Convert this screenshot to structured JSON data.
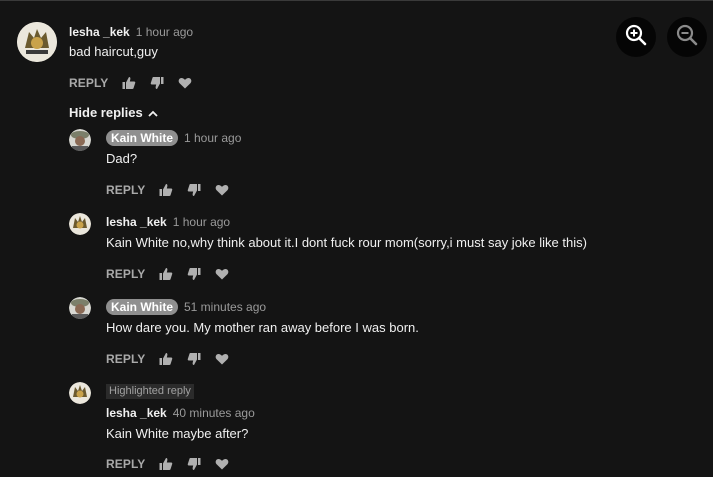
{
  "toolbar": {
    "zoom_in_icon": "zoom-in-icon",
    "zoom_out_icon": "zoom-out-icon"
  },
  "reply_label": "REPLY",
  "hide_replies_label": "Hide replies",
  "highlighted_label": "Highlighted reply",
  "comments": [
    {
      "author": "lesha _kek",
      "time": "1 hour ago",
      "text": "bad haircut,guy"
    },
    {
      "author": "Kain White",
      "time": "1 hour ago",
      "text": "Dad?"
    },
    {
      "author": "lesha _kek",
      "time": "1 hour ago",
      "text": "Kain White no,why think about it.I dont fuck rour mom(sorry,i must say joke like this)"
    },
    {
      "author": "Kain White",
      "time": "51 minutes ago",
      "text": "How dare you. My mother ran away before I was born."
    },
    {
      "author": "lesha _kek",
      "time": "40 minutes ago",
      "text": "Kain White maybe after?"
    }
  ],
  "colors": {
    "background": "#141414",
    "author_badge": "#8f8f8f",
    "secondary_text": "#9a9a9a"
  }
}
